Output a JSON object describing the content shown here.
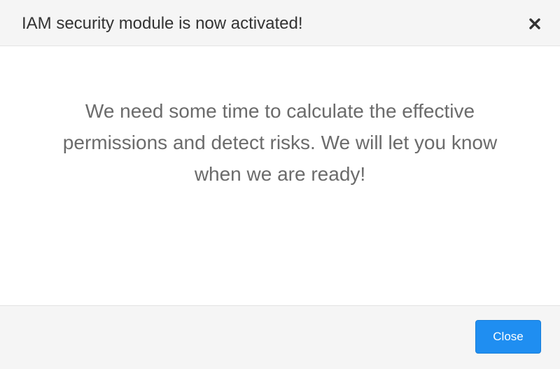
{
  "modal": {
    "title": "IAM security module is now activated!",
    "close_icon": "close-icon",
    "message": "We need some time to calculate the effective permissions and detect risks. We will let you know when we are ready!",
    "footer": {
      "close_label": "Close"
    }
  },
  "colors": {
    "primary_button": "#1f8ef1",
    "header_background": "#f5f5f5",
    "body_text": "#6b6b6b"
  }
}
